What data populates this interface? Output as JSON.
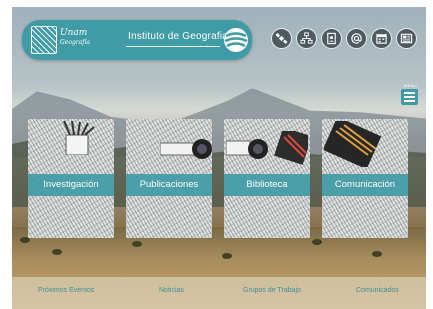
{
  "header": {
    "logo_script_line1": "Unam",
    "logo_script_line2": "Geografía",
    "title": "Instituto de Geografia"
  },
  "toolbar": {
    "icons": [
      "satellite-icon",
      "sitemap-icon",
      "contacts-book-icon",
      "at-sign-icon",
      "calendar-icon",
      "news-icon"
    ]
  },
  "menu": {
    "label": "MENU"
  },
  "cards": [
    {
      "label": "Investigación"
    },
    {
      "label": "Publicaciones"
    },
    {
      "label": "Biblioteca"
    },
    {
      "label": "Comunicación"
    }
  ],
  "bottom_nav": [
    {
      "label": "Próximos Eventos"
    },
    {
      "label": "Noticias"
    },
    {
      "label": "Grupos de Trabajo"
    },
    {
      "label": "Comunicados"
    }
  ],
  "colors": {
    "accent": "#3f9ba6",
    "icon_bg": "#4e5a60",
    "link": "#3f8f98"
  }
}
